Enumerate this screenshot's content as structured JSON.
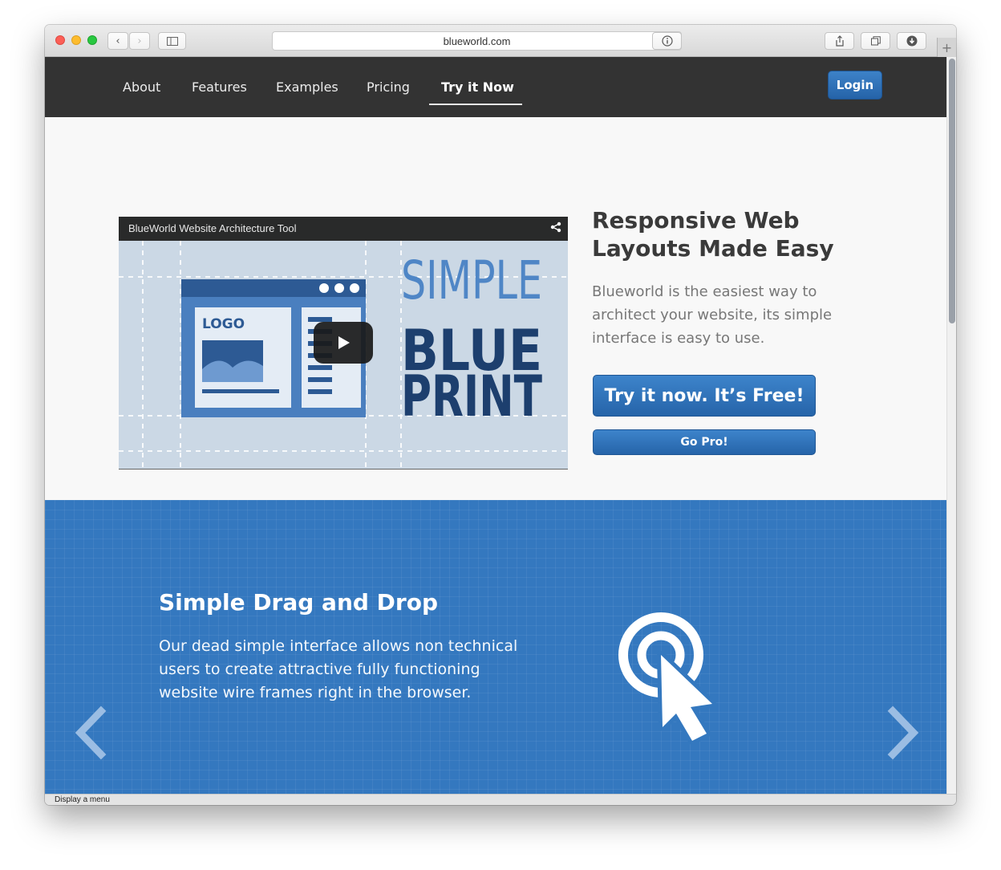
{
  "browser": {
    "url": "blueworld.com",
    "status_text": "Display a menu"
  },
  "nav": {
    "links": [
      "About",
      "Features",
      "Examples",
      "Pricing",
      "Try it Now"
    ],
    "active": "Try it Now",
    "login_label": "Login"
  },
  "hero": {
    "video_title": "BlueWorld Website Architecture Tool",
    "video_art": {
      "logo_text": "LOGO",
      "line1": "SIMPLE",
      "line2": "BLUE",
      "line3": "PRINT"
    },
    "heading": "Responsive Web Layouts Made Easy",
    "description": "Blueworld is the easiest way to architect your website, its simple interface is easy to use.",
    "cta_label": "Try it now. It’s Free!",
    "pro_label": "Go Pro!"
  },
  "feature": {
    "heading": "Simple Drag and Drop",
    "description": "Our dead simple interface allows non technical users to create attractive fully functioning website wire frames right in the browser."
  },
  "colors": {
    "nav_bg": "#333333",
    "brand_blue": "#3478bf",
    "button_blue": "#2e72b8"
  },
  "icons": [
    "back-icon",
    "forward-icon",
    "sidebar-icon",
    "reload-icon",
    "info-icon",
    "share-icon",
    "tabs-icon",
    "download-icon",
    "play-icon",
    "click-target-icon",
    "prev-arrow-icon",
    "next-arrow-icon"
  ]
}
